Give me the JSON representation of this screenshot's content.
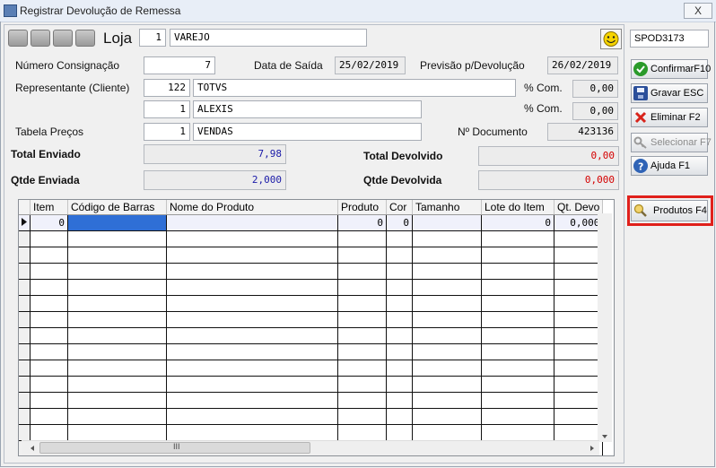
{
  "window": {
    "title": "Registrar Devolução de Remessa",
    "close": "X"
  },
  "header": {
    "loja_label": "Loja",
    "loja_code": "1",
    "loja_name": "VAREJO",
    "station": "SPOD3173"
  },
  "form": {
    "numero_consignacao_label": "Número Consignação",
    "numero_consignacao": "7",
    "data_saida_label": "Data de Saída",
    "data_saida": "25/02/2019",
    "previsao_label": "Previsão p/Devolução",
    "previsao": "26/02/2019",
    "representante_label": "Representante (Cliente)",
    "representante_code": "122",
    "representante_name": "TOTVS",
    "com_label": "% Com.",
    "com1": "0,00",
    "sub_code": "1",
    "sub_name": "ALEXIS",
    "com2": "0,00",
    "tabela_label": "Tabela Preços",
    "tabela_code": "1",
    "tabela_name": "VENDAS",
    "documento_label": "Nº Documento",
    "documento": "423136",
    "total_enviado_label": "Total Enviado",
    "total_enviado": "7,98",
    "total_devolvido_label": "Total Devolvido",
    "total_devolvido": "0,00",
    "qtde_enviada_label": "Qtde Enviada",
    "qtde_enviada": "2,000",
    "qtde_devolvida_label": "Qtde Devolvida",
    "qtde_devolvida": "0,000"
  },
  "sidebar": {
    "confirmar": "ConfirmarF10",
    "gravar": "Gravar  ESC",
    "eliminar": "Eliminar   F2",
    "selecionar": "Selecionar F7",
    "ajuda": "Ajuda    F1",
    "produtos": "Produtos F4"
  },
  "grid": {
    "columns": [
      "Item",
      "Código de Barras",
      "Nome do Produto",
      "Produto",
      "Cor",
      "Tamanho",
      "Lote do Item",
      "Qt. Devo"
    ],
    "row": {
      "item": "0",
      "codigo": "",
      "nome": "",
      "produto": "0",
      "cor": "0",
      "tamanho": "",
      "lote": "0",
      "qt": "0,000"
    },
    "scroll_grip": "III"
  },
  "colors": {
    "highlight_box": "#e0201b",
    "selected_cell": "#2f6fd6",
    "value_blue": "#1a1aa8",
    "value_red": "#d40000"
  }
}
